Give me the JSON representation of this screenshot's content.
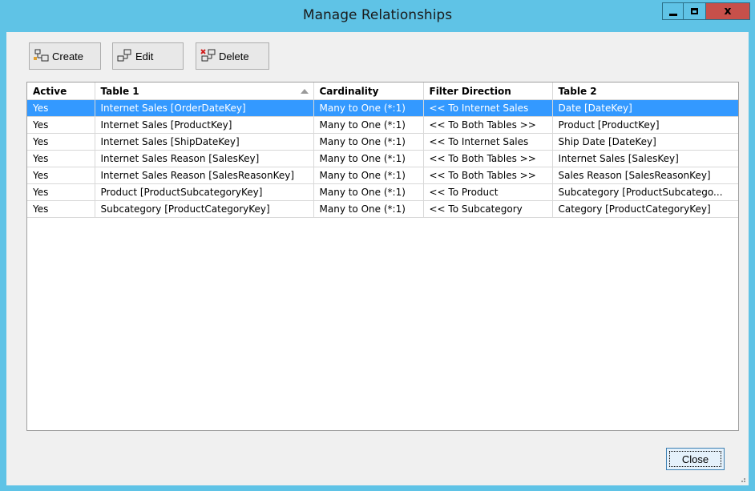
{
  "window": {
    "title": "Manage Relationships",
    "close_glyph": "x"
  },
  "toolbar": {
    "create_label": "Create",
    "edit_label": "Edit",
    "delete_label": "Delete"
  },
  "grid": {
    "columns": [
      "Active",
      "Table 1",
      "Cardinality",
      "Filter Direction",
      "Table 2"
    ],
    "sort_column": "Table 1",
    "sort_direction": "ascending",
    "selected_row": 0,
    "rows": [
      [
        "Yes",
        "Internet Sales [OrderDateKey]",
        "Many to One (*:1)",
        "<< To Internet Sales",
        "Date [DateKey]"
      ],
      [
        "Yes",
        "Internet Sales [ProductKey]",
        "Many to One (*:1)",
        "<< To Both Tables >>",
        "Product [ProductKey]"
      ],
      [
        "Yes",
        "Internet Sales [ShipDateKey]",
        "Many to One (*:1)",
        "<< To Internet Sales",
        "Ship Date [DateKey]"
      ],
      [
        "Yes",
        "Internet Sales Reason [SalesKey]",
        "Many to One (*:1)",
        "<< To Both Tables >>",
        "Internet Sales [SalesKey]"
      ],
      [
        "Yes",
        "Internet Sales Reason [SalesReasonKey]",
        "Many to One (*:1)",
        "<< To Both Tables >>",
        "Sales Reason [SalesReasonKey]"
      ],
      [
        "Yes",
        "Product [ProductSubcategoryKey]",
        "Many to One (*:1)",
        "<< To Product",
        "Subcategory [ProductSubcatego..."
      ],
      [
        "Yes",
        "Subcategory [ProductCategoryKey]",
        "Many to One (*:1)",
        "<< To Subcategory",
        "Category [ProductCategoryKey]"
      ]
    ]
  },
  "footer": {
    "close_label": "Close"
  },
  "colors": {
    "title_bar": "#5fc3e6",
    "close_button": "#c7504a",
    "selection": "#3399ff"
  }
}
